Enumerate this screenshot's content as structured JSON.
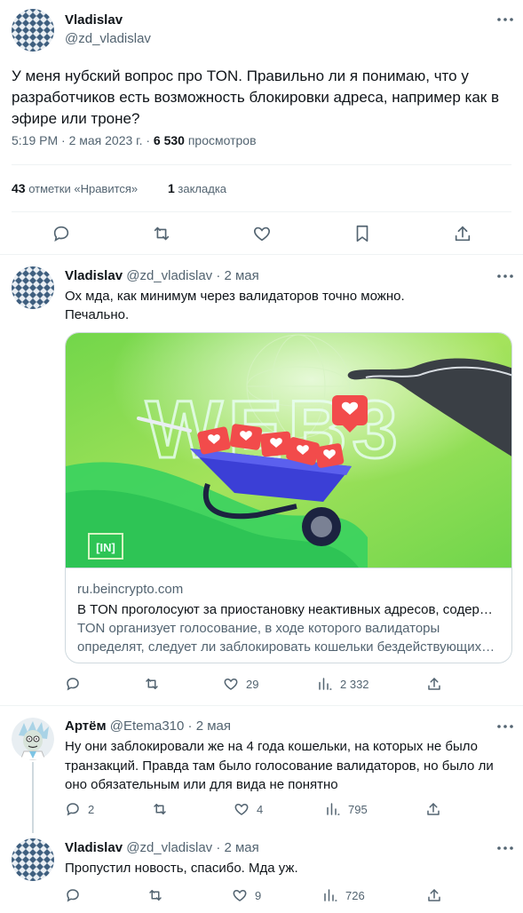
{
  "main_tweet": {
    "author_name": "Vladislav",
    "handle": "@zd_vladislav",
    "text_lines": [
      "У меня нубский вопрос про TON. Правильно ли я понимаю, что у",
      "разработчиков есть возможность блокировки адреса, например как в",
      "эфире или троне?"
    ],
    "time": "5:19 PM · 2 мая 2023 г. · ",
    "views_count": "6 530",
    "views_label": " просмотров",
    "likes_count": "43",
    "likes_label": " отметки «Нравится»",
    "bookmarks_count": "1",
    "bookmarks_label": " закладка"
  },
  "replies": [
    {
      "author_name": "Vladislav",
      "meta": "@zd_vladislav · 2 мая",
      "text_lines": [
        "Ох мда, как минимум через валидаторов точно можно.",
        "Печально."
      ],
      "card": {
        "domain": "ru.beincrypto.com",
        "title": "В TON проголосуют за приостановку неактивных адресов, содер…",
        "desc_lines": [
          "TON организует голосование, в ходе которого валидаторы",
          "определят, следует ли заблокировать кошельки бездействующих…"
        ],
        "image_text": "WEB3",
        "logo": "[IN]"
      },
      "actions": {
        "replies": "",
        "retweets": "",
        "likes": "29",
        "views": "2 332"
      }
    },
    {
      "author_name": "Артём",
      "meta": "@Etema310 · 2 мая",
      "text_lines": [
        "Ну они заблокировали же на 4 года кошельки, на которых не было",
        "транзакций. Правда там было голосование валидаторов, но было ли",
        "оно обязательным или для вида не понятно"
      ],
      "actions": {
        "replies": "2",
        "retweets": "",
        "likes": "4",
        "views": "795"
      }
    },
    {
      "author_name": "Vladislav",
      "meta": "@zd_vladislav · 2 мая",
      "text_lines": [
        "Пропустил новость, спасибо. Мда уж."
      ],
      "actions": {
        "replies": "",
        "retweets": "",
        "likes": "9",
        "views": "726"
      }
    }
  ],
  "colors": {
    "text": "#0f1419",
    "secondary": "#536471",
    "border": "#eff3f4",
    "accent_green": "#8be04e",
    "heart_red": "#f24b4b",
    "cart_blue": "#3b3fd6"
  }
}
